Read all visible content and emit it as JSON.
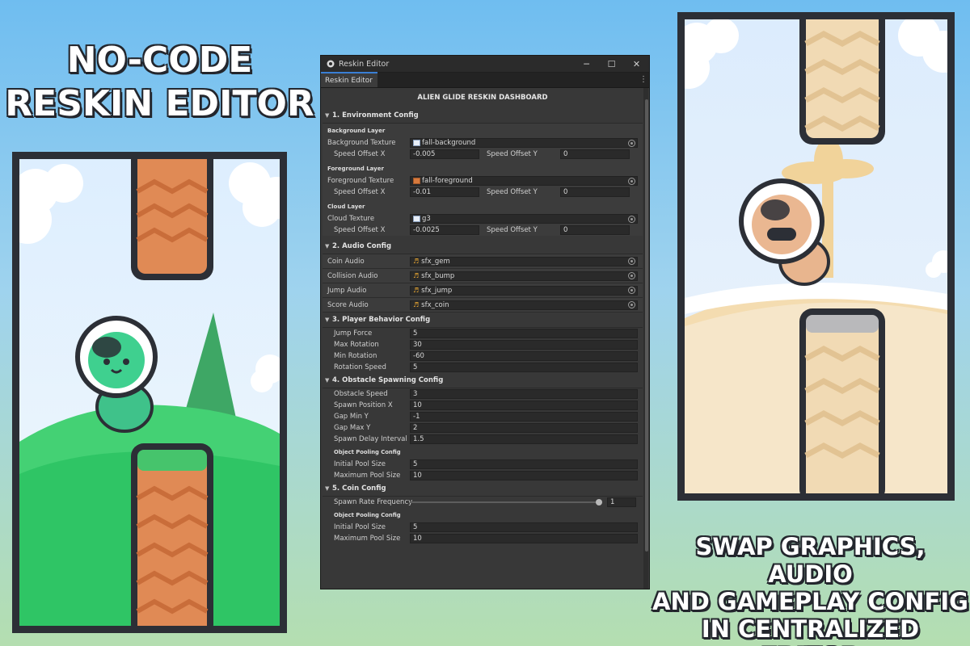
{
  "headline_left": [
    "NO-CODE",
    "RESKIN EDITOR"
  ],
  "headline_right": [
    "SWAP GRAPHICS, AUDIO",
    "AND GAMEPLAY CONFIG",
    "IN CENTRALIZED EDITOR"
  ],
  "colors": {
    "sky": "#6fbdf0",
    "panel_border": "#2c2f36",
    "grass": "#36c86a",
    "pipe_orange": "#e08a55",
    "pipe_sand": "#eed9b8",
    "editor_bg": "#383838",
    "tab_accent": "#3a7fd5"
  },
  "window": {
    "title": "Reskin Editor",
    "tab": "Reskin Editor",
    "icons": [
      "unity-icon",
      "minimize-icon",
      "maximize-icon",
      "close-icon",
      "kebab-menu-icon"
    ]
  },
  "dashboard_title": "ALIEN GLIDE RESKIN DASHBOARD",
  "env": {
    "header": "1. Environment Config",
    "bg": {
      "sub": "Background Layer",
      "tex_label": "Background Texture",
      "tex_value": "fall-background",
      "sx_label": "Speed Offset X",
      "sx_value": "-0.005",
      "sy_label": "Speed Offset Y",
      "sy_value": "0"
    },
    "fg": {
      "sub": "Foreground Layer",
      "tex_label": "Foreground Texture",
      "tex_value": "fall-foreground",
      "sx_label": "Speed Offset X",
      "sx_value": "-0.01",
      "sy_label": "Speed Offset Y",
      "sy_value": "0"
    },
    "cloud": {
      "sub": "Cloud Layer",
      "tex_label": "Cloud Texture",
      "tex_value": "g3",
      "sx_label": "Speed Offset X",
      "sx_value": "-0.0025",
      "sy_label": "Speed Offset Y",
      "sy_value": "0"
    }
  },
  "audio": {
    "header": "2. Audio Config",
    "rows": [
      {
        "label": "Coin Audio",
        "value": "sfx_gem"
      },
      {
        "label": "Collision Audio",
        "value": "sfx_bump"
      },
      {
        "label": "Jump Audio",
        "value": "sfx_jump"
      },
      {
        "label": "Score Audio",
        "value": "sfx_coin"
      }
    ]
  },
  "player": {
    "header": "3. Player Behavior Config",
    "rows": [
      {
        "label": "Jump Force",
        "value": "5"
      },
      {
        "label": "Max Rotation",
        "value": "30"
      },
      {
        "label": "Min Rotation",
        "value": "-60"
      },
      {
        "label": "Rotation Speed",
        "value": "5"
      }
    ]
  },
  "obstacle": {
    "header": "4. Obstacle Spawning Config",
    "rows": [
      {
        "label": "Obstacle Speed",
        "value": "3"
      },
      {
        "label": "Spawn Position X",
        "value": "10"
      },
      {
        "label": "Gap Min Y",
        "value": "-1"
      },
      {
        "label": "Gap Max Y",
        "value": "2"
      },
      {
        "label": "Spawn Delay Interval",
        "value": "1.5"
      }
    ],
    "pool_sub": "Object Pooling Config",
    "pool_rows": [
      {
        "label": "Initial Pool Size",
        "value": "5"
      },
      {
        "label": "Maximum Pool Size",
        "value": "10"
      }
    ]
  },
  "coin": {
    "header": "5. Coin Config",
    "slider_label": "Spawn Rate Frequency",
    "slider_value": "1",
    "slider_fraction": 1.0,
    "pool_sub": "Object Pooling Config",
    "pool_rows": [
      {
        "label": "Initial Pool Size",
        "value": "5"
      },
      {
        "label": "Maximum Pool Size",
        "value": "10"
      }
    ]
  }
}
